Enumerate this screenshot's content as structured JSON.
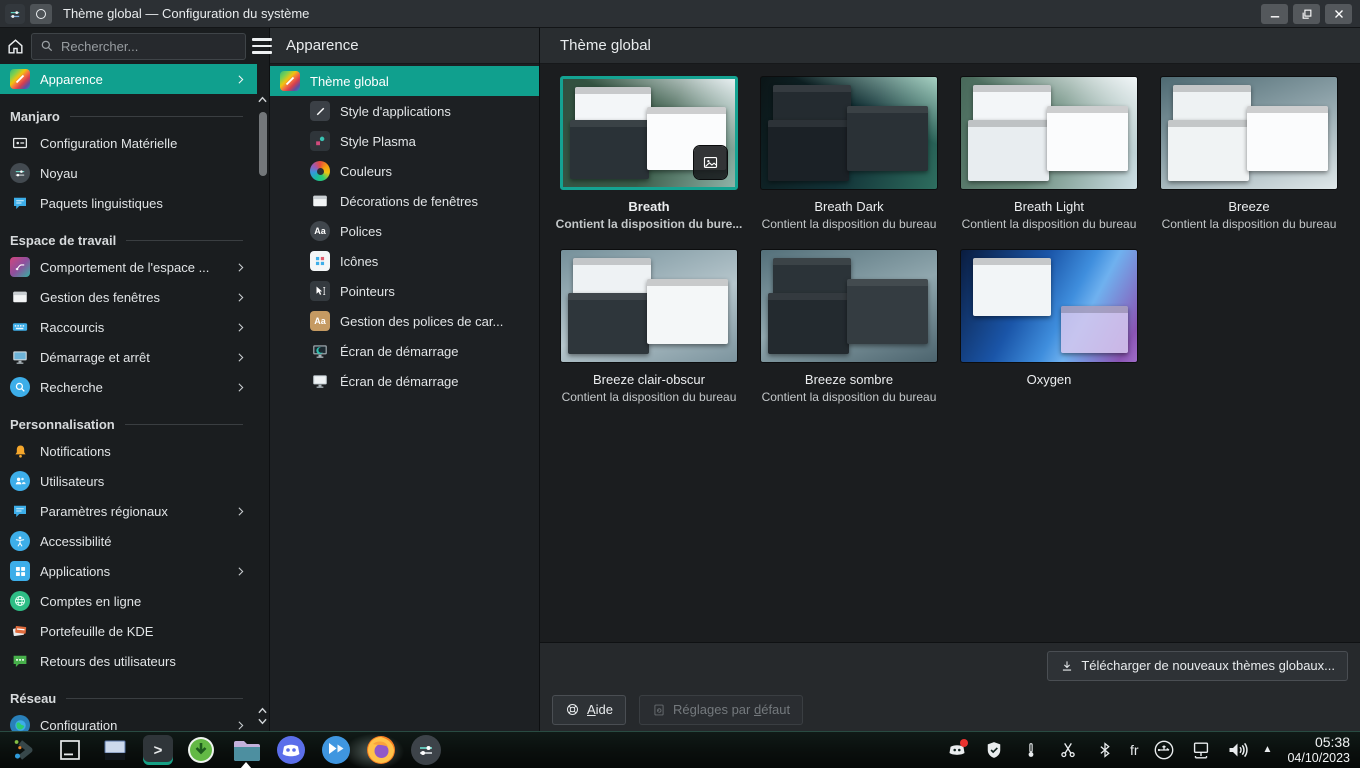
{
  "window": {
    "title": "Thème global — Configuration du système"
  },
  "sidebar": {
    "search_placeholder": "Rechercher...",
    "top_item": {
      "label": "Apparence"
    },
    "sections": [
      {
        "title": "Manjaro",
        "items": [
          {
            "label": "Configuration Matérielle"
          },
          {
            "label": "Noyau"
          },
          {
            "label": "Paquets linguistiques"
          }
        ]
      },
      {
        "title": "Espace de travail",
        "items": [
          {
            "label": "Comportement de l'espace ..."
          },
          {
            "label": "Gestion des fenêtres"
          },
          {
            "label": "Raccourcis"
          },
          {
            "label": "Démarrage et arrêt"
          },
          {
            "label": "Recherche"
          }
        ]
      },
      {
        "title": "Personnalisation",
        "items": [
          {
            "label": "Notifications"
          },
          {
            "label": "Utilisateurs"
          },
          {
            "label": "Paramètres régionaux"
          },
          {
            "label": "Accessibilité"
          },
          {
            "label": "Applications"
          },
          {
            "label": "Comptes en ligne"
          },
          {
            "label": "Portefeuille de KDE"
          },
          {
            "label": "Retours des utilisateurs"
          }
        ]
      },
      {
        "title": "Réseau",
        "items": [
          {
            "label": "Configuration"
          }
        ]
      }
    ]
  },
  "subpanel": {
    "header": "Apparence",
    "items": [
      {
        "label": "Thème global"
      },
      {
        "label": "Style d'applications"
      },
      {
        "label": "Style Plasma"
      },
      {
        "label": "Couleurs"
      },
      {
        "label": "Décorations de fenêtres"
      },
      {
        "label": "Polices"
      },
      {
        "label": "Icônes"
      },
      {
        "label": "Pointeurs"
      },
      {
        "label": "Gestion des polices de car..."
      },
      {
        "label": "Écran de démarrage"
      },
      {
        "label": "Écran de démarrage"
      }
    ]
  },
  "main": {
    "header": "Thème global",
    "themes": [
      {
        "name": "Breath",
        "subtitle": "Contient la disposition du bure..."
      },
      {
        "name": "Breath Dark",
        "subtitle": "Contient la disposition du bureau"
      },
      {
        "name": "Breath Light",
        "subtitle": "Contient la disposition du bureau"
      },
      {
        "name": "Breeze",
        "subtitle": "Contient la disposition du bureau"
      },
      {
        "name": "Breeze clair-obscur",
        "subtitle": "Contient la disposition du bureau"
      },
      {
        "name": "Breeze sombre",
        "subtitle": "Contient la disposition du bureau"
      },
      {
        "name": "Oxygen",
        "subtitle": ""
      }
    ],
    "download_button": "Télécharger de nouveaux thèmes globaux...",
    "help_button": {
      "mnemonic": "A",
      "rest": "ide"
    },
    "defaults_button": {
      "pre": "Réglages par ",
      "mnemonic": "d",
      "rest": "éfaut"
    }
  },
  "taskbar": {
    "keyboard_layout": "fr",
    "time": "05:38",
    "date": "04/10/2023"
  },
  "icons": {
    "caret_up": "▲",
    "aa_glyph": "Aa",
    "terminal_glyph": ">"
  },
  "colors": {
    "accent": "#10a08e",
    "card_selection_border": "#14a392",
    "titlebar": "#2c3034",
    "sidebar_bg": "#1a1d1f",
    "content_bg": "#1b1d1f"
  }
}
